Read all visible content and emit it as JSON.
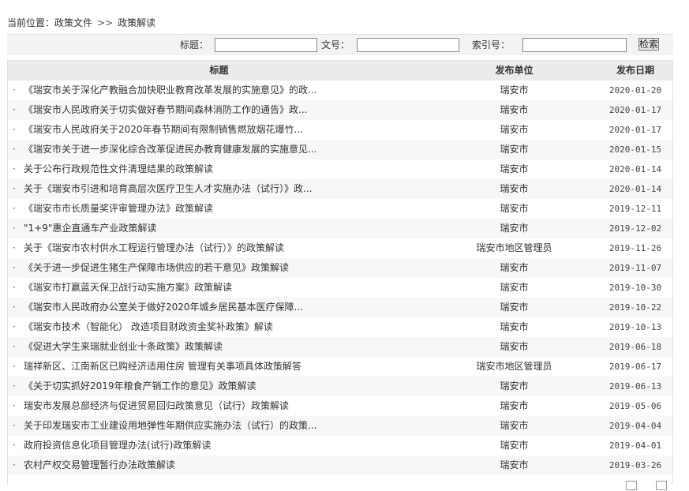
{
  "breadcrumb": {
    "label": "当前位置：",
    "items": [
      "政策文件",
      "政策解读"
    ],
    "separator": ">>"
  },
  "search": {
    "title_label": "标题：",
    "doc_no_label": "文号：",
    "index_label": "索引号：",
    "button_label": "检索"
  },
  "table": {
    "headers": {
      "title": "标题",
      "dept": "发布单位",
      "date": "发布日期"
    },
    "bullet": "·",
    "rows": [
      {
        "title": "《瑞安市关于深化产教融合加快职业教育改革发展的实施意见》的政...",
        "dept": "瑞安市",
        "date": "2020-01-20"
      },
      {
        "title": "《瑞安市人民政府关于切实做好春节期间森林消防工作的通告》政...",
        "dept": "瑞安市",
        "date": "2020-01-17"
      },
      {
        "title": "《瑞安市人民政府关于2020年春节期间有限制销售燃放烟花爆竹...",
        "dept": "瑞安市",
        "date": "2020-01-17"
      },
      {
        "title": "《瑞安市关于进一步深化综合改革促进民办教育健康发展的实施意见...",
        "dept": "瑞安市",
        "date": "2020-01-15"
      },
      {
        "title": "关于公布行政规范性文件清理结果的政策解读",
        "dept": "瑞安市",
        "date": "2020-01-14"
      },
      {
        "title": "关于《瑞安市引进和培育高层次医疗卫生人才实施办法（试行）》政...",
        "dept": "瑞安市",
        "date": "2020-01-14"
      },
      {
        "title": "《瑞安市市长质量奖评审管理办法》政策解读",
        "dept": "瑞安市",
        "date": "2019-12-11"
      },
      {
        "title": "\"1+9\"惠企直通车产业政策解读",
        "dept": "瑞安市",
        "date": "2019-12-02"
      },
      {
        "title": "关于《瑞安市农村供水工程运行管理办法（试行）》的政策解读",
        "dept": "瑞安市地区管理员",
        "date": "2019-11-26"
      },
      {
        "title": "《关于进一步促进生猪生产保障市场供应的若干意见》政策解读",
        "dept": "瑞安市",
        "date": "2019-11-07"
      },
      {
        "title": "《瑞安市打赢蓝天保卫战行动实施方案》政策解读",
        "dept": "瑞安市",
        "date": "2019-10-30"
      },
      {
        "title": "《瑞安市人民政府办公室关于做好2020年城乡居民基本医疗保障...",
        "dept": "瑞安市",
        "date": "2019-10-22"
      },
      {
        "title": "《瑞安市技术（智能化） 改造项目财政资金奖补政策》解读",
        "dept": "瑞安市",
        "date": "2019-10-13"
      },
      {
        "title": "《促进大学生来瑞就业创业十条政策》政策解读",
        "dept": "瑞安市",
        "date": "2019-06-18"
      },
      {
        "title": "瑞祥新区、江南新区已购经济适用住房 管理有关事项具体政策解答",
        "dept": "瑞安市地区管理员",
        "date": "2019-06-17"
      },
      {
        "title": "《关于切实抓好2019年粮食产销工作的意见》政策解读",
        "dept": "瑞安市",
        "date": "2019-06-13"
      },
      {
        "title": "瑞安市发展总部经济与促进贸易回归政策意见（试行）政策解读",
        "dept": "瑞安市",
        "date": "2019-05-06"
      },
      {
        "title": "关于印发瑞安市工业建设用地弹性年期供应实施办法（试行）的政策...",
        "dept": "瑞安市",
        "date": "2019-04-04"
      },
      {
        "title": "政府投资信息化项目管理办法(试行)政策解读",
        "dept": "瑞安市",
        "date": "2019-04-01"
      },
      {
        "title": "农村产权交易管理暂行办法政策解读",
        "dept": "瑞安市",
        "date": "2019-03-26"
      }
    ]
  }
}
